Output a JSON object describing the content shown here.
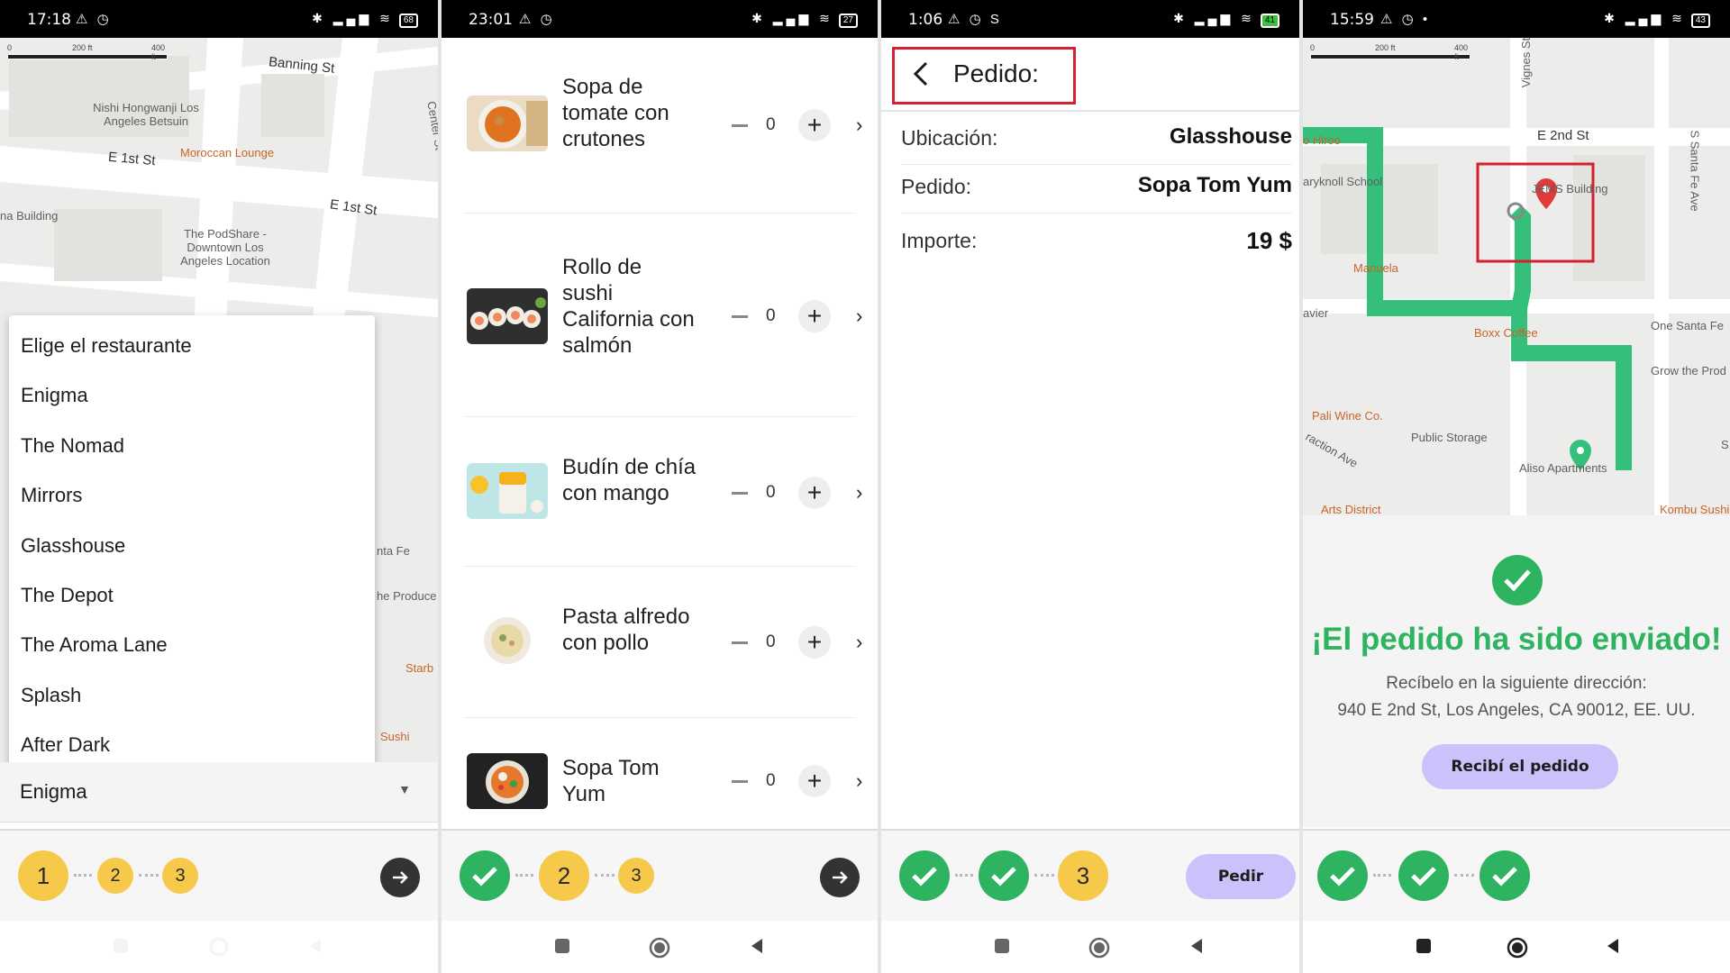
{
  "screens": {
    "s1": {
      "status": {
        "time": "17:18",
        "battery": "68"
      },
      "map": {
        "scale_left": "0",
        "scale_mid": "200 ft",
        "scale_right": "400 ft",
        "labels": {
          "banning": "Banning St",
          "nishi": "Nishi Hongwanji Los Angeles Betsuin",
          "moroccan": "Moroccan Lounge",
          "e1st_a": "E 1st St",
          "e1st_b": "E 1st St",
          "center": "Center St",
          "building": "na Building",
          "podshare": "The PodShare - Downtown Los Angeles Location",
          "ntafe": "nta Fe",
          "produce": "he Produce",
          "starb": "Starb",
          "sushi": "Sushi"
        }
      },
      "dropdown": {
        "items": [
          "Elige el restaurante",
          "Enigma",
          "The Nomad",
          "Mirrors",
          "Glasshouse",
          "The Depot",
          "The Aroma Lane",
          "Splash",
          "After Dark"
        ]
      },
      "select_value": "Enigma",
      "steps": [
        "1",
        "2",
        "3"
      ]
    },
    "s2": {
      "status": {
        "time": "23:01",
        "battery": "27"
      },
      "items": [
        {
          "name": "Sopa de tomate con crutones",
          "qty": "0"
        },
        {
          "name": "Rollo de sushi California con salmón",
          "qty": "0"
        },
        {
          "name": "Budín de chía con mango",
          "qty": "0"
        },
        {
          "name": "Pasta alfredo con pollo",
          "qty": "0"
        },
        {
          "name": "Sopa Tom Yum",
          "qty": "0"
        }
      ],
      "steps": [
        "2",
        "3"
      ]
    },
    "s3": {
      "status": {
        "time": "1:06",
        "battery": "41"
      },
      "title": "Pedido:",
      "rows": [
        {
          "label": "Ubicación:",
          "value": "Glasshouse"
        },
        {
          "label": "Pedido:",
          "value": "Sopa Tom Yum"
        },
        {
          "label": "Importe:",
          "value": "19 $"
        }
      ],
      "steps": [
        "3"
      ],
      "order_button": "Pedir"
    },
    "s4": {
      "status": {
        "time": "15:59",
        "battery": "43"
      },
      "map": {
        "scale_left": "0",
        "scale_mid": "200 ft",
        "scale_right": "400 ft",
        "labels": {
          "vignes": "Vignes St",
          "hiroo": "o Hiroo",
          "e2nd": "E 2nd St",
          "santafe": "S Santa Fe Ave",
          "maryknoll": "aryknoll School",
          "jems": "JEMS Building",
          "manuela": "Manuela",
          "avier": "avier",
          "boxx": "Boxx Coffee",
          "onesantafe": "One Santa Fe",
          "grow": "Grow the Prod",
          "pali": "Pali Wine Co.",
          "storage": "Public Storage",
          "traction": "raction Ave",
          "aliso": "Aliso Apartments",
          "arts": "Arts District",
          "kombu": "Kombu Sushi",
          "s_edge": "S"
        }
      },
      "success": {
        "headline": "¡El pedido ha sido enviado!",
        "line1": "Recíbelo en la siguiente dirección:",
        "line2": "940 E 2nd St, Los Angeles, CA 90012, EE. UU.",
        "button": "Recibí el pedido"
      }
    }
  },
  "colors": {
    "accent_green": "#2eb460",
    "step_yellow": "#f6c94a",
    "button_purple": "#c9c2fb",
    "highlight_red": "#d52030"
  }
}
